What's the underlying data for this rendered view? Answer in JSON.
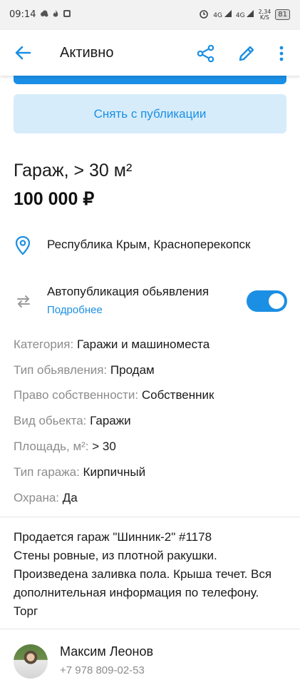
{
  "status_bar": {
    "time": "09:14",
    "net_speed_value": "2,34",
    "net_speed_unit": "K/S",
    "battery": "81",
    "signal_1": "4G",
    "signal_2": "4G"
  },
  "app_bar": {
    "title": "Активно"
  },
  "actions": {
    "unpublish_label": "Снять с публикации"
  },
  "listing": {
    "title": "Гараж, > 30 м²",
    "price": "100 000 ₽",
    "location": "Республика Крым, Красноперекопск"
  },
  "autopublish": {
    "label": "Автопубликация обьявления",
    "more_link": "Подробнее",
    "enabled": true
  },
  "attributes": [
    {
      "key": "Категория:",
      "value": "Гаражи и машиноместа"
    },
    {
      "key": "Тип обьявления:",
      "value": "Продам"
    },
    {
      "key": "Право собственности:",
      "value": "Собственник"
    },
    {
      "key": "Вид обьекта:",
      "value": "Гаражи"
    },
    {
      "key": "Площадь, м²:",
      "value": "> 30"
    },
    {
      "key": "Тип гаража:",
      "value": "Кирпичный"
    },
    {
      "key": "Охрана:",
      "value": "Да"
    }
  ],
  "description": {
    "lines": [
      "Продается гараж \"Шинник-2\" #1178",
      "Стены ровные, из плотной ракушки.",
      "Произведена заливка пола. Крыша течет. Вся",
      "дополнительная информация по телефону.",
      "Торг"
    ]
  },
  "seller": {
    "name": "Максим Леонов",
    "phone": "+7 978 809-02-53"
  },
  "colors": {
    "accent": "#1b8fe3",
    "accent_light": "#d6ecfb",
    "muted_text": "#8c8c8c"
  },
  "icons": {
    "back": "arrow-left-icon",
    "share": "share-icon",
    "edit": "pencil-icon",
    "more": "more-vertical-icon",
    "location": "location-pin-icon",
    "autopublish": "repeat-arrows-icon"
  }
}
